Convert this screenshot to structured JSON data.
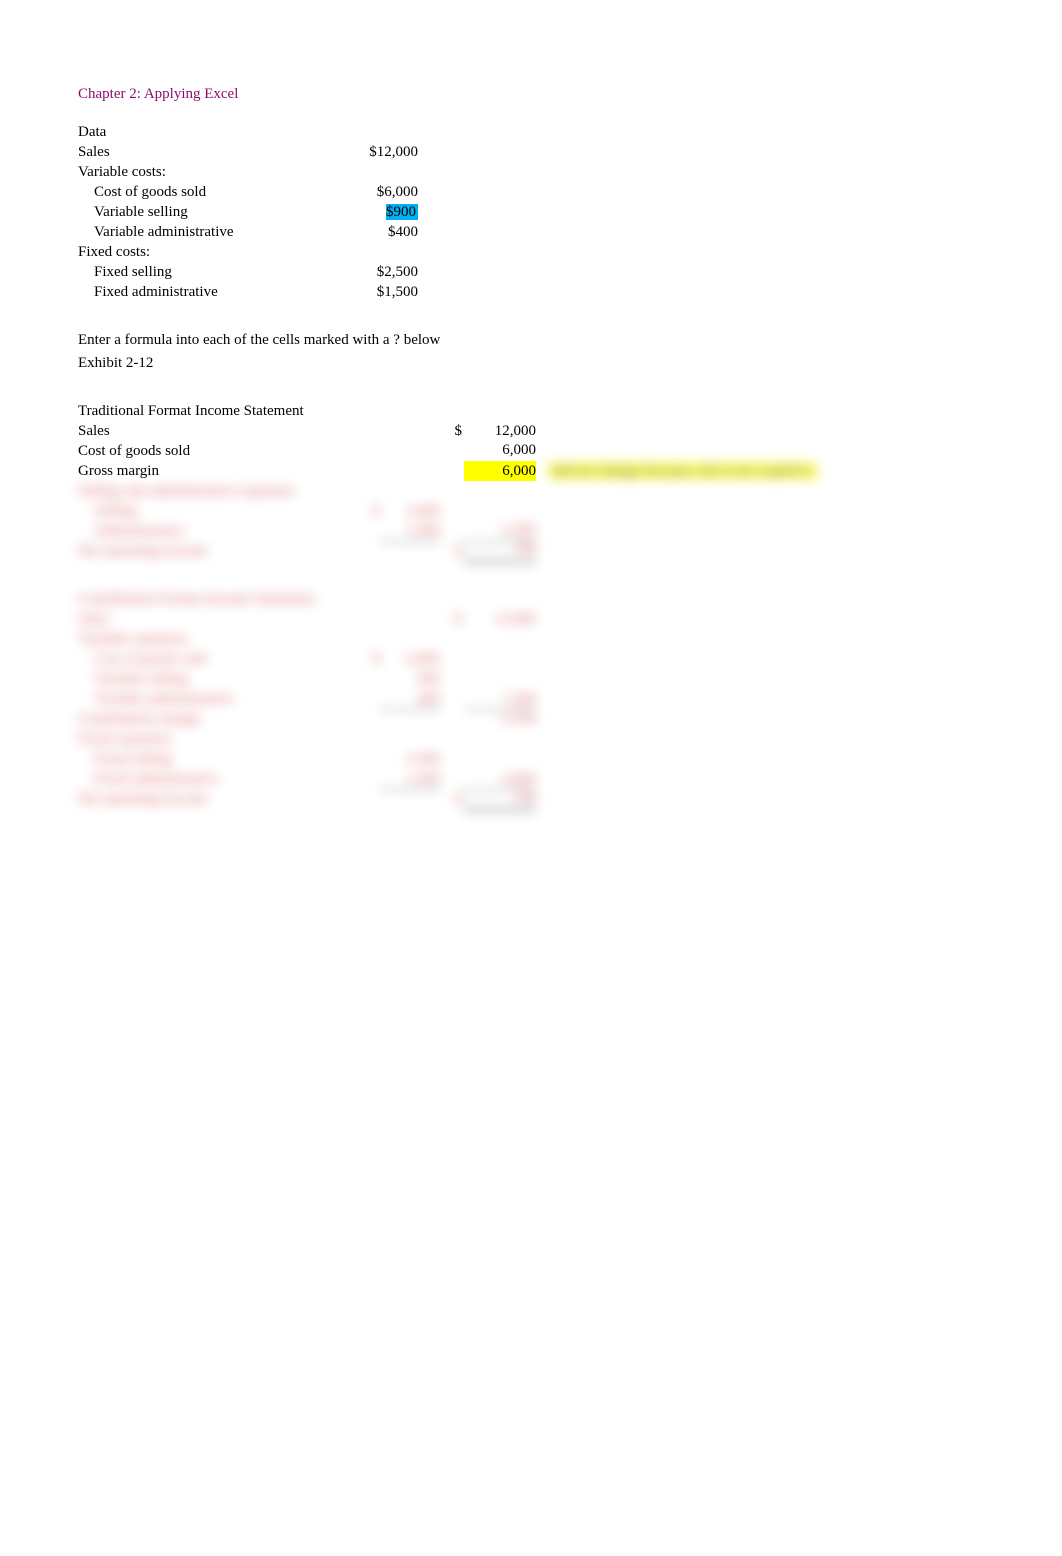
{
  "title": "Chapter 2: Applying Excel",
  "data_section": {
    "header": "Data",
    "sales_label": "Sales",
    "sales_value": "$12,000",
    "variable_header": "Variable costs:",
    "cogs_label": "Cost of goods sold",
    "cogs_value": "$6,000",
    "var_selling_label": "Variable selling",
    "var_selling_value": "$900",
    "var_admin_label": "Variable administrative",
    "var_admin_value": "$400",
    "fixed_header": "Fixed costs:",
    "fixed_selling_label": "Fixed selling",
    "fixed_selling_value": "$2,500",
    "fixed_admin_label": "Fixed administrative",
    "fixed_admin_value": "$1,500"
  },
  "instruction": "Enter a formula into each of the cells marked with a ? below",
  "exhibit": "Exhibit 2-12",
  "trad": {
    "header": "Traditional Format Income Statement",
    "sales_label": "Sales",
    "sales_sym": "$",
    "sales_val": "12,000",
    "cogs_label": "Cost of goods sold",
    "cogs_val": "6,000",
    "gm_label": "Gross margin",
    "gm_val": "6,000",
    "gm_note": "did not change because cell is not copied to",
    "sga_label": "Selling and administrative expenses:",
    "selling_label": "Selling",
    "selling_sym": "$",
    "selling_val": "3,400",
    "admin_label": "Administrative",
    "admin_val": "1,900",
    "sga_total": "5,300",
    "noi_label": "Net operating income",
    "noi_sym": "$",
    "noi_val": "700"
  },
  "contrib": {
    "header": "Contribution Format Income Statement",
    "sales_label": "Sales",
    "sales_sym": "$",
    "sales_val": "12,000",
    "ve_header": "Variable expenses:",
    "cogs_label": "Cost of goods sold",
    "cogs_sym": "$",
    "cogs_val": "6,000",
    "var_selling_label": "Variable selling",
    "var_selling_val": "900",
    "var_admin_label": "Variable administrative",
    "var_admin_val": "400",
    "ve_total": "7,300",
    "cm_label": "Contribution margin",
    "cm_val": "4,700",
    "fe_header": "Fixed expenses:",
    "fixed_selling_label": "Fixed selling",
    "fixed_selling_val": "2,500",
    "fixed_admin_label": "Fixed administrative",
    "fixed_admin_val": "1,500",
    "fe_total": "4,000",
    "noi_label": "Net operating income",
    "noi_sym": "$",
    "noi_val": "700"
  },
  "chart_data": {
    "type": "table",
    "title": "Chapter 2: Applying Excel",
    "data_inputs": {
      "Sales": 12000,
      "Variable costs": {
        "Cost of goods sold": 6000,
        "Variable selling": 900,
        "Variable administrative": 400
      },
      "Fixed costs": {
        "Fixed selling": 2500,
        "Fixed administrative": 1500
      }
    },
    "traditional_income_statement": {
      "Sales": 12000,
      "Cost of goods sold": 6000,
      "Gross margin": 6000,
      "Selling and administrative expenses": {
        "Selling": 3400,
        "Administrative": 1900,
        "total": 5300
      },
      "Net operating income": 700
    },
    "contribution_income_statement": {
      "Sales": 12000,
      "Variable expenses": {
        "Cost of goods sold": 6000,
        "Variable selling": 900,
        "Variable administrative": 400,
        "total": 7300
      },
      "Contribution margin": 4700,
      "Fixed expenses": {
        "Fixed selling": 2500,
        "Fixed administrative": 1500,
        "total": 4000
      },
      "Net operating income": 700
    }
  }
}
